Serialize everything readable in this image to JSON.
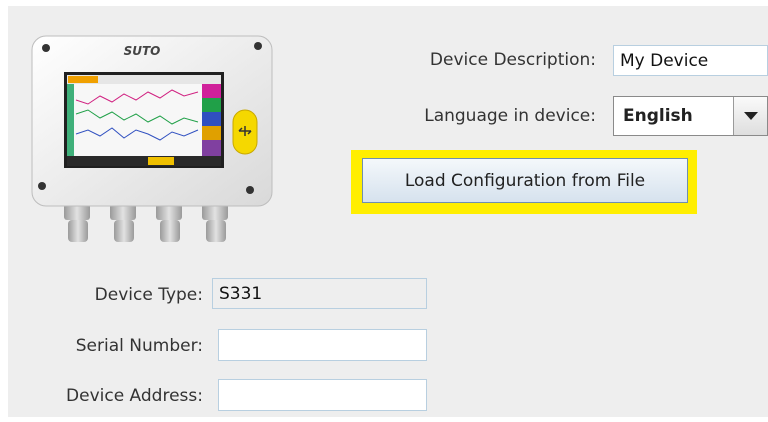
{
  "device": {
    "logo_text": "SUTO",
    "description_label": "Device Description:",
    "description_value": "My Device",
    "language_label": "Language in device:",
    "language_value": "English",
    "load_button_label": "Load Configuration from File",
    "type_label": "Device Type:",
    "type_value": "S331",
    "serial_label": "Serial Number:",
    "serial_value": "",
    "address_label": "Device Address:",
    "address_value": ""
  },
  "colors": {
    "highlight": "#ffee00",
    "panel_bg": "#eeeeee",
    "field_border": "#b8cfe0"
  },
  "icons": [
    "device-image",
    "chevron-down-icon",
    "usb-icon"
  ]
}
